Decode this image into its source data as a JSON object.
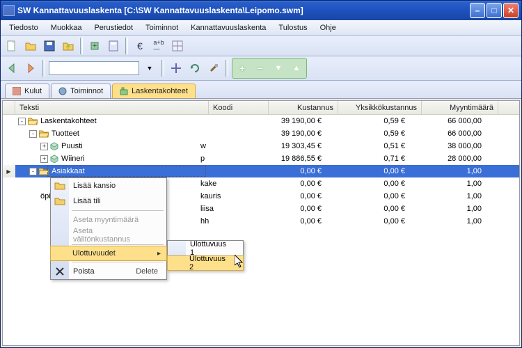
{
  "titlebar": "SW Kannattavuuslaskenta [C:\\SW Kannattavuuslaskenta\\Leipomo.swm]",
  "menubar": [
    "Tiedosto",
    "Muokkaa",
    "Perustiedot",
    "Toiminnot",
    "Kannattavuuslaskenta",
    "Tulostus",
    "Ohje"
  ],
  "tabs": {
    "kulut": "Kulut",
    "toiminnot": "Toiminnot",
    "laskentakohteet": "Laskentakohteet"
  },
  "columns": {
    "c1": "Teksti",
    "c2": "Koodi",
    "c3": "Kustannus",
    "c4": "Yksikkökustannus",
    "c5": "Myyntimäärä"
  },
  "rows": [
    {
      "label": "Laskentakohteet",
      "kind": "folder-open",
      "indent": 0,
      "toggle": "-",
      "koodi": "",
      "kust": "39 190,00 €",
      "yks": "0,59 €",
      "my": "66 000,00"
    },
    {
      "label": "Tuotteet",
      "kind": "folder-open",
      "indent": 1,
      "toggle": "-",
      "koodi": "",
      "kust": "39 190,00 €",
      "yks": "0,59 €",
      "my": "66 000,00"
    },
    {
      "label": "Puusti",
      "kind": "cube",
      "indent": 2,
      "toggle": "+",
      "koodi": "w",
      "kust": "19 303,45 €",
      "yks": "0,51 €",
      "my": "38 000,00"
    },
    {
      "label": "Wiineri",
      "kind": "cube",
      "indent": 2,
      "toggle": "+",
      "koodi": "p",
      "kust": "19 886,55 €",
      "yks": "0,71 €",
      "my": "28 000,00"
    },
    {
      "label": "Asiakkaat",
      "kind": "folder-open",
      "indent": 1,
      "toggle": "-",
      "koodi": "",
      "kust": "0,00 €",
      "yks": "0,00 €",
      "my": "1,00",
      "selected": true,
      "editing": true
    },
    {
      "label": "",
      "kind": "hidden",
      "indent": 2,
      "koodi": "kake",
      "kust": "0,00 €",
      "yks": "0,00 €",
      "my": "1,00"
    },
    {
      "label": "öpiiri",
      "kind": "hidden",
      "indent": 2,
      "koodi": "kauris",
      "kust": "0,00 €",
      "yks": "0,00 €",
      "my": "1,00"
    },
    {
      "label": "",
      "kind": "hidden",
      "indent": 2,
      "koodi": "liisa",
      "kust": "0,00 €",
      "yks": "0,00 €",
      "my": "1,00"
    },
    {
      "label": "",
      "kind": "hidden",
      "indent": 2,
      "koodi": "hh",
      "kust": "0,00 €",
      "yks": "0,00 €",
      "my": "1,00"
    }
  ],
  "context_menu": {
    "add_folder": "Lisää kansio",
    "add_account": "Lisää tili",
    "set_qty": "Aseta myyntimäärä",
    "set_cost": "Aseta välitönkustannus",
    "dimensions": "Ulottuvuudet",
    "delete": "Poista",
    "delete_key": "Delete"
  },
  "submenu": {
    "dim1": "Ulottuvuus 1",
    "dim2": "Ulottuvuus 2"
  }
}
